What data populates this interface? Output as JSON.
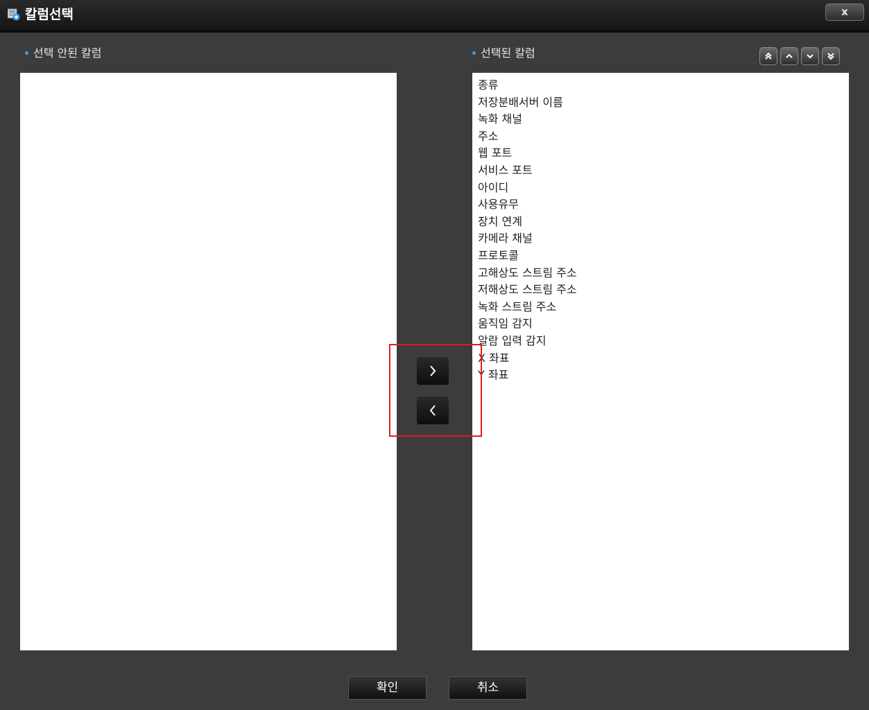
{
  "window": {
    "title": "칼럼선택",
    "close_label": "x"
  },
  "left_panel": {
    "label": "선택 안된 칼럼",
    "items": []
  },
  "right_panel": {
    "label": "선택된 칼럼",
    "items": [
      "종류",
      "저장분배서버 이름",
      "녹화 채널",
      "주소",
      "웹 포트",
      "서비스 포트",
      "아이디",
      "사용유무",
      "장치 연계",
      "카메라 채널",
      "프로토콜",
      "고해상도 스트림 주소",
      "저해상도 스트림 주소",
      "녹화 스트림 주소",
      "움직임 감지",
      "알람 입력 감지",
      "X 좌표",
      "Y 좌표"
    ]
  },
  "order_buttons": [
    "double-chevron-up-icon",
    "chevron-up-icon",
    "chevron-down-icon",
    "double-chevron-down-icon"
  ],
  "move_buttons": [
    "chevron-right-icon",
    "chevron-left-icon"
  ],
  "footer": {
    "ok_label": "확인",
    "cancel_label": "취소"
  },
  "colors": {
    "background": "#3c3c3c",
    "titlebar": "#161616",
    "bullet": "#3aa0ff",
    "highlight": "#e21b1b"
  }
}
